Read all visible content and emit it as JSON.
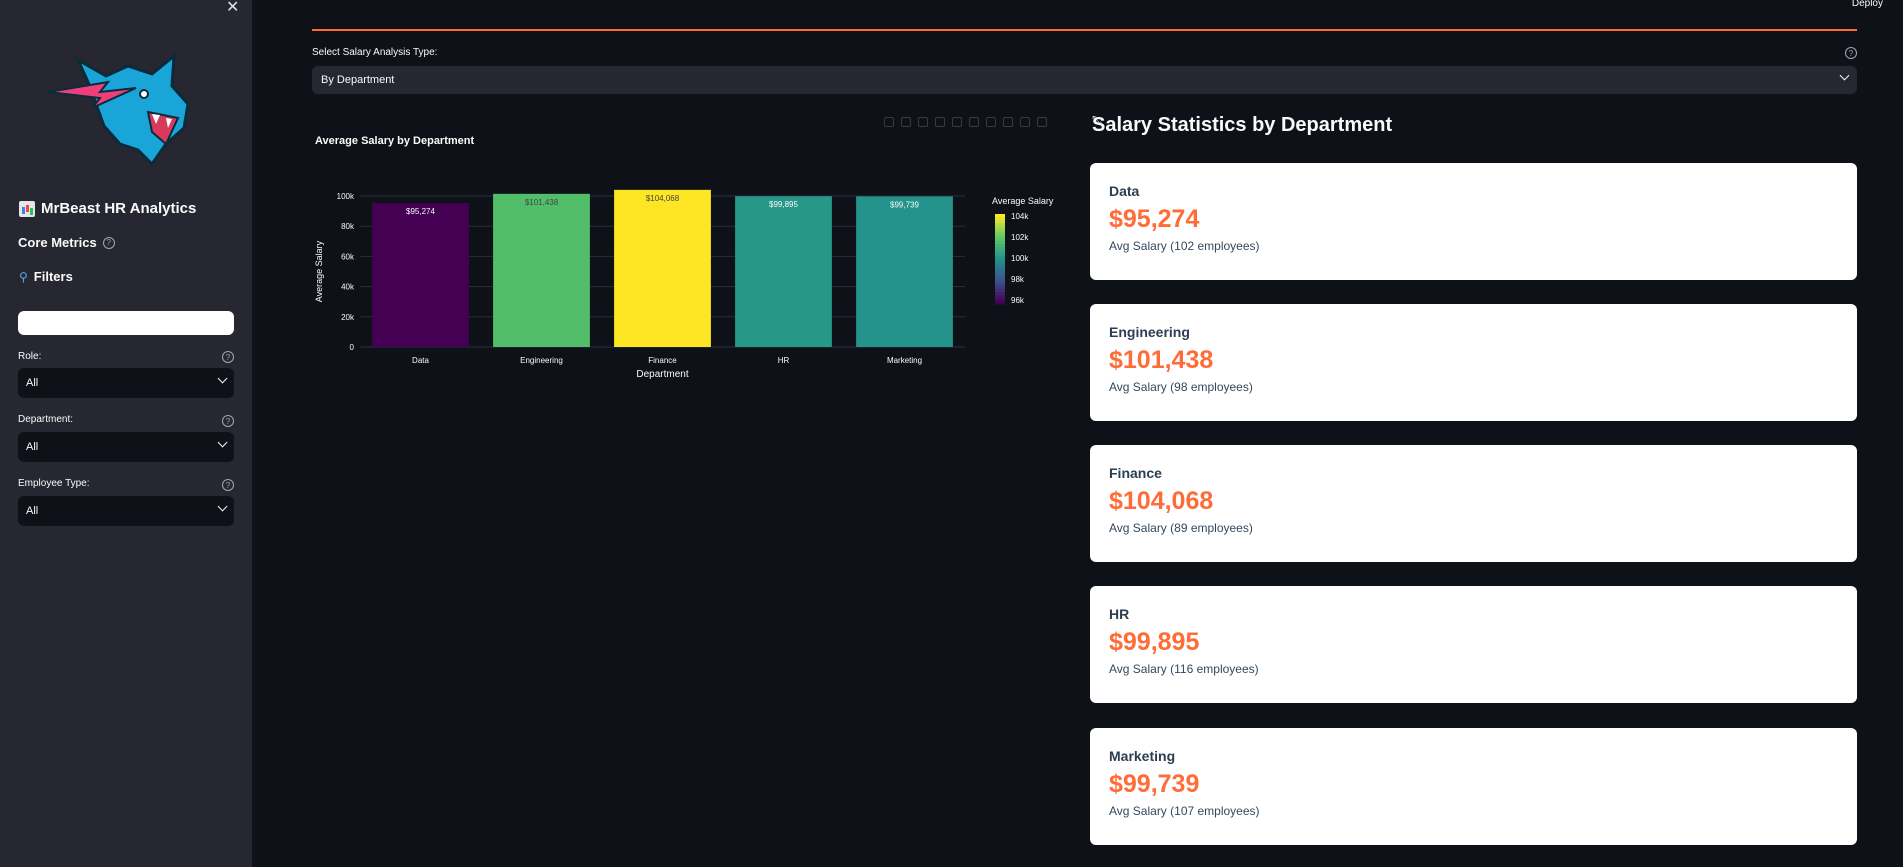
{
  "sidebar": {
    "app_title": "MrBeast HR Analytics",
    "core_metrics_label": "Core Metrics",
    "filters_label": "Filters",
    "search_placeholder": "",
    "filters": [
      {
        "label": "Role:",
        "value": "All"
      },
      {
        "label": "Department:",
        "value": "All"
      },
      {
        "label": "Employee Type:",
        "value": "All"
      }
    ]
  },
  "header": {
    "deploy_label": "Deploy"
  },
  "analysis": {
    "select_label": "Select Salary Analysis Type:",
    "selected_value": "By Department"
  },
  "chart": {
    "title": "Average Salary by Department"
  },
  "chart_data": {
    "type": "bar",
    "title": "Average Salary by Department",
    "xlabel": "Department",
    "ylabel": "Average Salary",
    "categories": [
      "Data",
      "Engineering",
      "Finance",
      "HR",
      "Marketing"
    ],
    "values": [
      95274,
      101438,
      104068,
      99895,
      99739
    ],
    "data_labels": [
      "$95,274",
      "$101,438",
      "$104,068",
      "$99,895",
      "$99,739"
    ],
    "ylim": [
      0,
      100000
    ],
    "yticks": [
      0,
      20000,
      40000,
      60000,
      80000,
      100000
    ],
    "ytick_labels": [
      "0",
      "20k",
      "40k",
      "60k",
      "80k",
      "100k"
    ],
    "colorbar": {
      "title": "Average Salary",
      "ticks": [
        "104k",
        "102k",
        "100k",
        "98k",
        "96k"
      ],
      "colorscale": "viridis",
      "range": [
        95274,
        104068
      ]
    },
    "grid": true
  },
  "stats": {
    "title": "Salary Statistics by Department",
    "cards": [
      {
        "name": "Data",
        "value": "$95,274",
        "sub": "Avg Salary (102 employees)"
      },
      {
        "name": "Engineering",
        "value": "$101,438",
        "sub": "Avg Salary (98 employees)"
      },
      {
        "name": "Finance",
        "value": "$104,068",
        "sub": "Avg Salary (89 employees)"
      },
      {
        "name": "HR",
        "value": "$99,895",
        "sub": "Avg Salary (116 employees)"
      },
      {
        "name": "Marketing",
        "value": "$99,739",
        "sub": "Avg Salary (107 employees)"
      }
    ]
  },
  "colors": {
    "accent": "#ff6c37",
    "sidebar_bg": "#262730",
    "main_bg": "#0e1117"
  }
}
